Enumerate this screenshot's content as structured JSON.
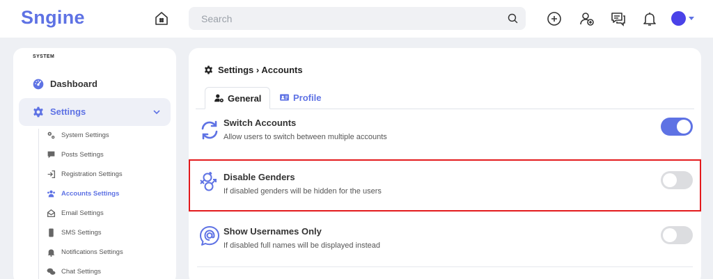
{
  "header": {
    "logo": "Sngine",
    "search_placeholder": "Search"
  },
  "sidebar": {
    "section_label": "SYSTEM",
    "items": [
      {
        "label": "Dashboard",
        "icon": "dashboard-gauge-icon"
      },
      {
        "label": "Settings",
        "icon": "gear-icon"
      }
    ],
    "sub_items": [
      {
        "label": "System Settings",
        "icon": "gears-icon"
      },
      {
        "label": "Posts Settings",
        "icon": "comment-icon"
      },
      {
        "label": "Registration Settings",
        "icon": "sign-in-icon"
      },
      {
        "label": "Accounts Settings",
        "icon": "users-icon"
      },
      {
        "label": "Email Settings",
        "icon": "envelope-open-icon"
      },
      {
        "label": "SMS Settings",
        "icon": "mobile-icon"
      },
      {
        "label": "Notifications Settings",
        "icon": "bell-icon"
      },
      {
        "label": "Chat Settings",
        "icon": "comments-icon"
      }
    ]
  },
  "main": {
    "breadcrumb": "Settings › Accounts",
    "tabs": [
      {
        "label": "General",
        "icon": "user-gear-icon"
      },
      {
        "label": "Profile",
        "icon": "id-card-icon"
      }
    ],
    "rows": [
      {
        "title": "Switch Accounts",
        "desc": "Allow users to switch between multiple accounts",
        "enabled": true,
        "icon": "sync-icon"
      },
      {
        "title": "Disable Genders",
        "desc": "If disabled genders will be hidden for the users",
        "enabled": false,
        "icon": "genders-icon"
      },
      {
        "title": "Show Usernames Only",
        "desc": "If disabled full names will be displayed instead",
        "enabled": false,
        "icon": "at-chat-icon"
      }
    ]
  },
  "colors": {
    "accent": "#5e72e4",
    "highlight": "#e31a1c"
  }
}
